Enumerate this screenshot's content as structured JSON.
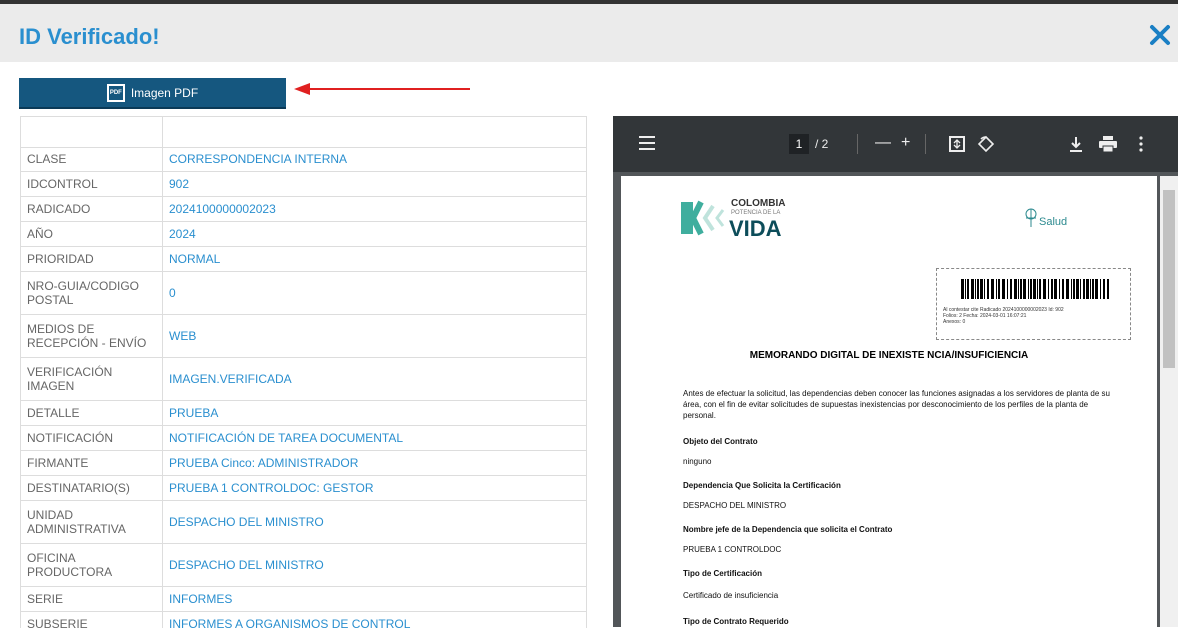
{
  "header": {
    "title": "ID Verificado!"
  },
  "pdf_button": {
    "label": "Imagen PDF",
    "icon_text": "PDF"
  },
  "details": [
    {
      "key": "",
      "value": ""
    },
    {
      "key": "CLASE",
      "value": "CORRESPONDENCIA INTERNA"
    },
    {
      "key": "IDCONTROL",
      "value": "902"
    },
    {
      "key": "RADICADO",
      "value": "2024100000002023"
    },
    {
      "key": "AÑO",
      "value": "2024"
    },
    {
      "key": "PRIORIDAD",
      "value": "NORMAL"
    },
    {
      "key": "NRO-GUIA/CODIGO POSTAL",
      "value": "0"
    },
    {
      "key": "MEDIOS DE RECEPCIÓN - ENVÍO",
      "value": "WEB"
    },
    {
      "key": "VERIFICACIÓN IMAGEN",
      "value": "IMAGEN.VERIFICADA"
    },
    {
      "key": "DETALLE",
      "value": "PRUEBA"
    },
    {
      "key": "NOTIFICACIÓN",
      "value": "NOTIFICACIÓN DE TAREA DOCUMENTAL"
    },
    {
      "key": "FIRMANTE",
      "value": "PRUEBA Cinco: ADMINISTRADOR"
    },
    {
      "key": "DESTINATARIO(S)",
      "value": "PRUEBA 1 CONTROLDOC: GESTOR"
    },
    {
      "key": "UNIDAD ADMINISTRATIVA",
      "value": "DESPACHO DEL MINISTRO"
    },
    {
      "key": "OFICINA PRODUCTORA",
      "value": "DESPACHO DEL MINISTRO"
    },
    {
      "key": "SERIE",
      "value": "INFORMES"
    },
    {
      "key": "SUBSERIE",
      "value": "INFORMES A ORGANISMOS DE CONTROL"
    }
  ],
  "pdf_viewer": {
    "page_current": "1",
    "page_total": "/ 2",
    "zoom_out": "—",
    "zoom_in": "+",
    "logo_colombia": "COLOMBIA",
    "logo_potencia": "POTENCIA DE LA",
    "logo_vida": "VIDA",
    "salud": "Salud",
    "barcode_text1": "Al contestar cite Radicado 2024100000002023 Id: 902",
    "barcode_text2": "Folios: 2 Fecha: 2024-03-01 16:07:21",
    "barcode_text3": "Anexos: 0",
    "doc_title": "MEMORANDO DIGITAL DE INEXISTE NCIA/INSUFICIENCIA",
    "paragraph": "Antes de efectuar la solicitud, las dependencias deben conocer las funciones asignadas a los servidores de planta de su área, con el fin de evitar solicitudes de supuestas inexistencias por desconocimiento de los perfiles de la planta de personal.",
    "objeto_label": "Objeto del Contrato",
    "objeto_value": "ninguno",
    "dependencia_label": "Dependencia Que Solicita la Certificación",
    "dependencia_value": "DESPACHO DEL MINISTRO",
    "jefe_label": "Nombre jefe de la Dependencia que solicita el Contrato",
    "jefe_value": "PRUEBA 1 CONTROLDOC",
    "tipo_cert_label": "Tipo de Certificación",
    "tipo_cert_value": "Certificado de insuficiencia",
    "tipo_contrato_label": "Tipo de Contrato Requerido"
  },
  "colors": {
    "title": "#2a8fcf",
    "button": "#15577f",
    "arrow": "#e02020",
    "toolbar": "#323639"
  }
}
